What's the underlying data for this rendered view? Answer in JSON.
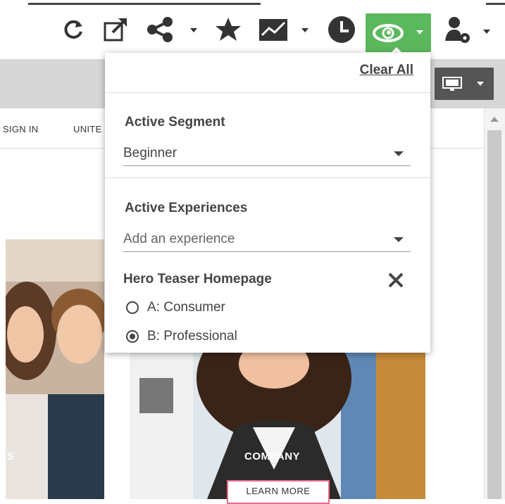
{
  "toolbar": {
    "icons": [
      "refresh-icon",
      "open-external-icon",
      "share-icon",
      "star-icon",
      "analytics-icon",
      "history-icon",
      "preview-eye-icon",
      "user-settings-icon"
    ],
    "accent_color": "#5cb85c"
  },
  "background_page": {
    "nav_items": [
      "SIGN IN",
      "UNITE"
    ],
    "hero_caption_left": "S",
    "hero_caption": "COMPANY",
    "hero_button": "LEARN MORE"
  },
  "panel": {
    "clear_all": "Clear All",
    "segment": {
      "heading": "Active Segment",
      "value": "Beginner"
    },
    "experiences": {
      "heading": "Active Experiences",
      "placeholder": "Add an experience",
      "items": [
        {
          "name": "Hero Teaser Homepage",
          "options": [
            {
              "label": "A: Consumer",
              "selected": false
            },
            {
              "label": "B: Professional",
              "selected": true
            }
          ]
        }
      ]
    }
  }
}
